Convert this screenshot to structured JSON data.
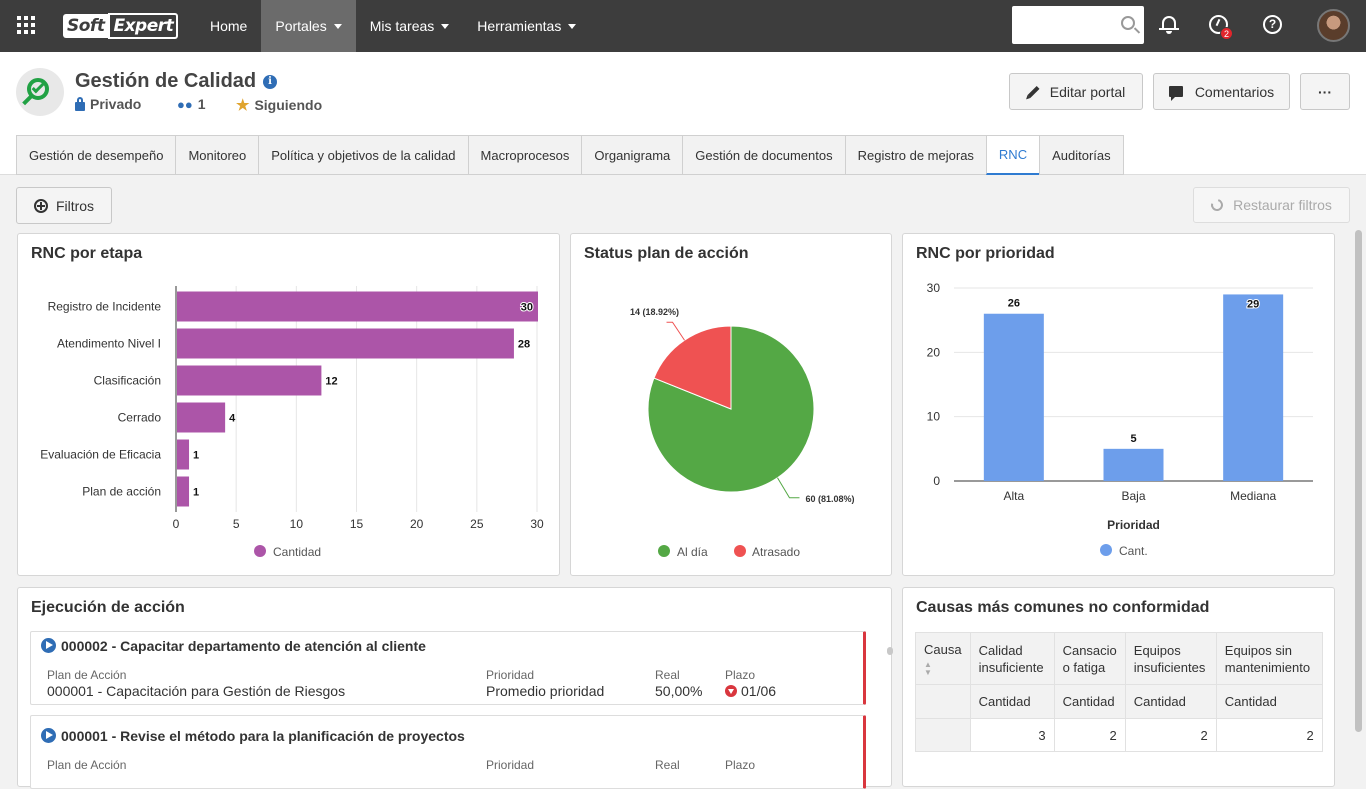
{
  "topbar": {
    "logo_part1": "Soft",
    "logo_part2": "Expert",
    "nav": [
      {
        "label": "Home",
        "has_caret": false
      },
      {
        "label": "Portales",
        "has_caret": true
      },
      {
        "label": "Mis tareas",
        "has_caret": true
      },
      {
        "label": "Herramientas",
        "has_caret": true
      }
    ],
    "search_value": "",
    "notification_badge": "2"
  },
  "portal": {
    "title": "Gestión de Calidad",
    "privacy": "Privado",
    "members": "1",
    "follow_status": "Siguiendo",
    "edit_button": "Editar portal",
    "comments_button": "Comentarios",
    "more_button": "···"
  },
  "tabs": [
    {
      "label": "Gestión de desempeño",
      "active": false
    },
    {
      "label": "Monitoreo",
      "active": false
    },
    {
      "label": "Política y objetivos de la calidad",
      "active": false
    },
    {
      "label": "Macroprocesos",
      "active": false
    },
    {
      "label": "Organigrama",
      "active": false
    },
    {
      "label": "Gestión de documentos",
      "active": false
    },
    {
      "label": "Registro de mejoras",
      "active": false
    },
    {
      "label": "RNC",
      "active": true
    },
    {
      "label": "Auditorías",
      "active": false
    }
  ],
  "filters": {
    "filter_button": "Filtros",
    "reset_button": "Restaurar filtros"
  },
  "colors": {
    "bar_purple": "#ac55a8",
    "pie_green": "#54a845",
    "pie_red": "#ef5252",
    "bar_blue": "#6d9eeb",
    "accent_blue": "#2f7bd1",
    "late_red": "#d9363e"
  },
  "chart_data": [
    {
      "type": "bar",
      "orientation": "horizontal",
      "title": "RNC por etapa",
      "categories": [
        "Registro de Incidente",
        "Atendimento Nivel I",
        "Clasificación",
        "Cerrado",
        "Evaluación de Eficacia",
        "Plan de acción"
      ],
      "series": [
        {
          "name": "Cantidad",
          "values": [
            30,
            28,
            12,
            4,
            1,
            1
          ]
        }
      ],
      "xlim": [
        0,
        30
      ],
      "xticks": [
        0,
        5,
        10,
        15,
        20,
        25,
        30
      ],
      "grid": true,
      "legend": "bottom"
    },
    {
      "type": "pie",
      "title": "Status plan de acción",
      "slices": [
        {
          "name": "Al día",
          "value": 60,
          "label": "60 (81.08%)"
        },
        {
          "name": "Atrasado",
          "value": 14,
          "label": "14 (18.92%)"
        }
      ],
      "legend": "bottom"
    },
    {
      "type": "bar",
      "orientation": "vertical",
      "title": "RNC por prioridad",
      "categories": [
        "Alta",
        "Baja",
        "Mediana"
      ],
      "series": [
        {
          "name": "Cant.",
          "values": [
            26,
            5,
            29
          ]
        }
      ],
      "xlabel": "Prioridad",
      "ylim": [
        0,
        30
      ],
      "yticks": [
        0,
        10,
        20,
        30
      ],
      "grid": true,
      "legend": "bottom"
    }
  ],
  "execution": {
    "title": "Ejecución de acción",
    "items": [
      {
        "title": "000002 - Capacitar departamento de atención al cliente",
        "plan_label": "Plan de Acción",
        "plan_value": "000001 - Capacitación para Gestión de Riesgos",
        "priority_label": "Prioridad",
        "priority_value": "Promedio prioridad",
        "real_label": "Real",
        "real_value": "50,00%",
        "deadline_label": "Plazo",
        "deadline_value": "01/06"
      },
      {
        "title": "000001 - Revise el método para la planificación de proyectos",
        "plan_label": "Plan de Acción",
        "priority_label": "Prioridad",
        "real_label": "Real",
        "deadline_label": "Plazo"
      }
    ]
  },
  "causes": {
    "title": "Causas más comunes no conformidad",
    "first_header": "Causa",
    "columns": [
      "Calidad insuficiente",
      "Cansacio o fatiga",
      "Equipos insuficientes",
      "Equipos sin mantenimiento"
    ],
    "sub_header": "Cantidad",
    "values": [
      "3",
      "2",
      "2",
      "2"
    ]
  }
}
